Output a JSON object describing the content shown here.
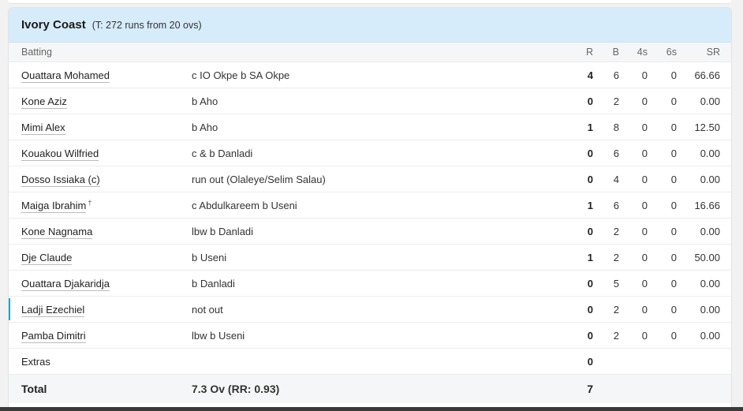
{
  "header": {
    "team": "Ivory Coast",
    "target": "(T: 272 runs from 20 ovs)"
  },
  "columns": {
    "batting": "Batting",
    "r": "R",
    "b": "B",
    "fours": "4s",
    "sixes": "6s",
    "sr": "SR"
  },
  "batters": [
    {
      "name": "Ouattara Mohamed",
      "dismissal": "c IO Okpe b SA Okpe",
      "r": "4",
      "b": "6",
      "fours": "0",
      "sixes": "0",
      "sr": "66.66"
    },
    {
      "name": "Kone Aziz",
      "dismissal": "b Aho",
      "r": "0",
      "b": "2",
      "fours": "0",
      "sixes": "0",
      "sr": "0.00"
    },
    {
      "name": "Mimi Alex",
      "dismissal": "b Aho",
      "r": "1",
      "b": "8",
      "fours": "0",
      "sixes": "0",
      "sr": "12.50"
    },
    {
      "name": "Kouakou Wilfried",
      "dismissal": "c & b Danladi",
      "r": "0",
      "b": "6",
      "fours": "0",
      "sixes": "0",
      "sr": "0.00"
    },
    {
      "name": "Dosso Issiaka (c)",
      "dismissal": "run out (Olaleye/Selim Salau)",
      "r": "0",
      "b": "4",
      "fours": "0",
      "sixes": "0",
      "sr": "0.00"
    },
    {
      "name": "Maiga Ibrahim",
      "keeper": "†",
      "dismissal": "c Abdulkareem b Useni",
      "r": "1",
      "b": "6",
      "fours": "0",
      "sixes": "0",
      "sr": "16.66"
    },
    {
      "name": "Kone Nagnama",
      "dismissal": "lbw b Danladi",
      "r": "0",
      "b": "2",
      "fours": "0",
      "sixes": "0",
      "sr": "0.00"
    },
    {
      "name": "Dje Claude",
      "dismissal": "b Useni",
      "r": "1",
      "b": "2",
      "fours": "0",
      "sixes": "0",
      "sr": "50.00"
    },
    {
      "name": "Ouattara Djakaridja",
      "dismissal": "b Danladi",
      "r": "0",
      "b": "5",
      "fours": "0",
      "sixes": "0",
      "sr": "0.00"
    },
    {
      "name": "Ladji Ezechiel",
      "dismissal": "not out",
      "r": "0",
      "b": "2",
      "fours": "0",
      "sixes": "0",
      "sr": "0.00"
    },
    {
      "name": "Pamba Dimitri",
      "dismissal": "lbw b Useni",
      "r": "0",
      "b": "2",
      "fours": "0",
      "sixes": "0",
      "sr": "0.00"
    }
  ],
  "extras": {
    "label": "Extras",
    "value": "0"
  },
  "total": {
    "label": "Total",
    "overs": "7.3 Ov (RR: 0.93)",
    "runs": "7"
  },
  "colors": {
    "header_bg": "#d6ecfb",
    "highlight_bar": "#1aa3c8"
  }
}
